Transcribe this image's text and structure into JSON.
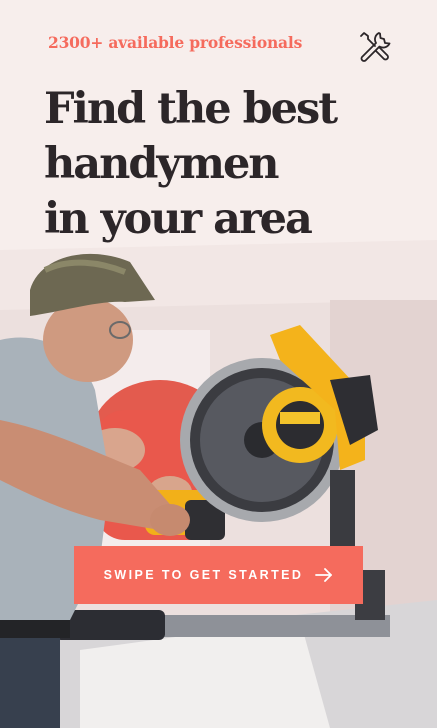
{
  "app": {
    "tagline": "2300+ available professionals",
    "headline_lines": [
      "Find the best",
      "handymen",
      "in your area"
    ],
    "cta_label": "SWIPE TO GET STARTED",
    "icons": {
      "brand": "tools-icon",
      "cta": "arrow-right-icon"
    }
  },
  "colors": {
    "accent": "#f56b5d",
    "headline": "#2c2629",
    "cta_text": "#ffffff"
  }
}
